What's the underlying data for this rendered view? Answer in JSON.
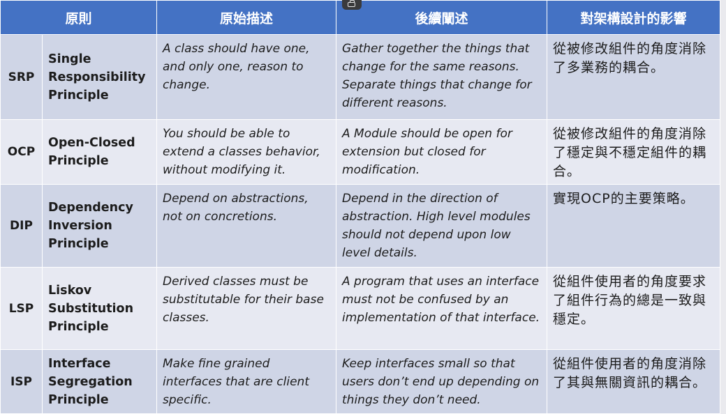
{
  "header": {
    "principle": "原則",
    "original": "原始描述",
    "explanation": "後續闡述",
    "impact": "對架構設計的影響"
  },
  "rows": [
    {
      "abbr": "SRP",
      "name": "Single Responsibility Principle",
      "original": "A class should have one, and only one, reason to change.",
      "explanation": "Gather together the things that change for the same reasons. Separate things that change for different reasons.",
      "impact": "從被修改組件的角度消除了多業務的耦合。"
    },
    {
      "abbr": "OCP",
      "name": "Open-Closed Principle",
      "original": "You should be able to extend a classes behavior, without modifying it.",
      "explanation": "A Module should be open for extension but closed for modification.",
      "impact": "從被修改組件的角度消除了穩定與不穩定組件的耦合。"
    },
    {
      "abbr": "DIP",
      "name": "Dependency Inversion Principle",
      "original": "Depend on abstractions, not on concretions.",
      "explanation": "Depend in the direction of abstraction. High level modules should not depend upon low level details.",
      "impact": "實現OCP的主要策略。"
    },
    {
      "abbr": "LSP",
      "name": "Liskov Substitution Principle",
      "original": "Derived classes must be substitutable for their base classes.",
      "explanation": "A program that uses an interface must not be confused by an implementation of that interface.",
      "impact": "從組件使用者的角度要求了組件行為的總是一致與穩定。"
    },
    {
      "abbr": "ISP",
      "name": "Interface Segregation Principle",
      "original": "Make fine grained interfaces that are client specific.",
      "explanation": "Keep interfaces small so that users don’t end up depending on things they don’t need.",
      "impact": "從組件使用者的角度消除了其與無關資訊的耦合。"
    }
  ],
  "colors": {
    "header_bg": "#4472c4",
    "row_dark": "#cfd5e6",
    "row_light": "#e7e9f2"
  }
}
